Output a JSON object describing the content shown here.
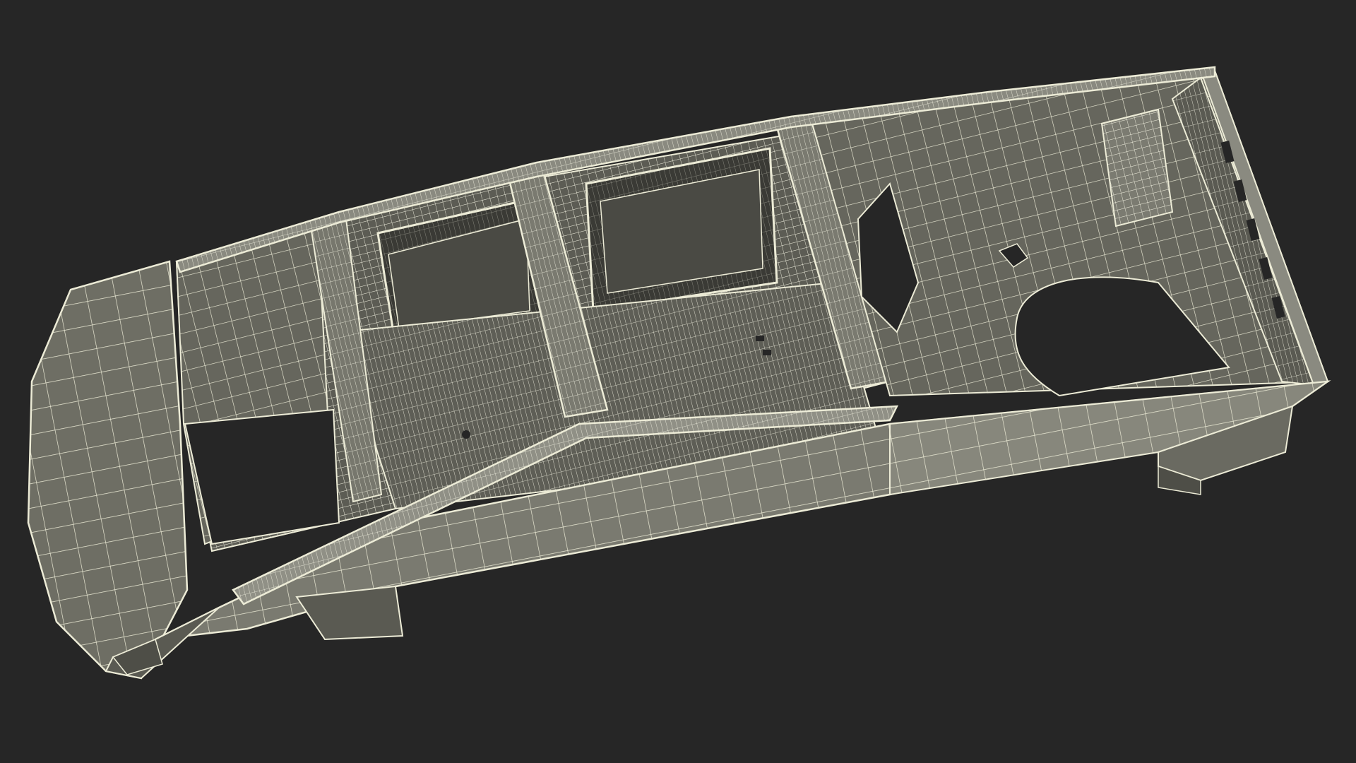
{
  "scene": {
    "subject": "vehicle-body-wireframe",
    "render_mode": "wireframe-on-shaded"
  },
  "colors": {
    "background": "#262626",
    "surface": "#6e6e64",
    "surface_light": "#818176",
    "surface_dark": "#4e4e47",
    "cavity": "#3a3a35",
    "hole": "#262626",
    "wire": "#ecebd6",
    "wire_dense": "#f4f3e2"
  }
}
